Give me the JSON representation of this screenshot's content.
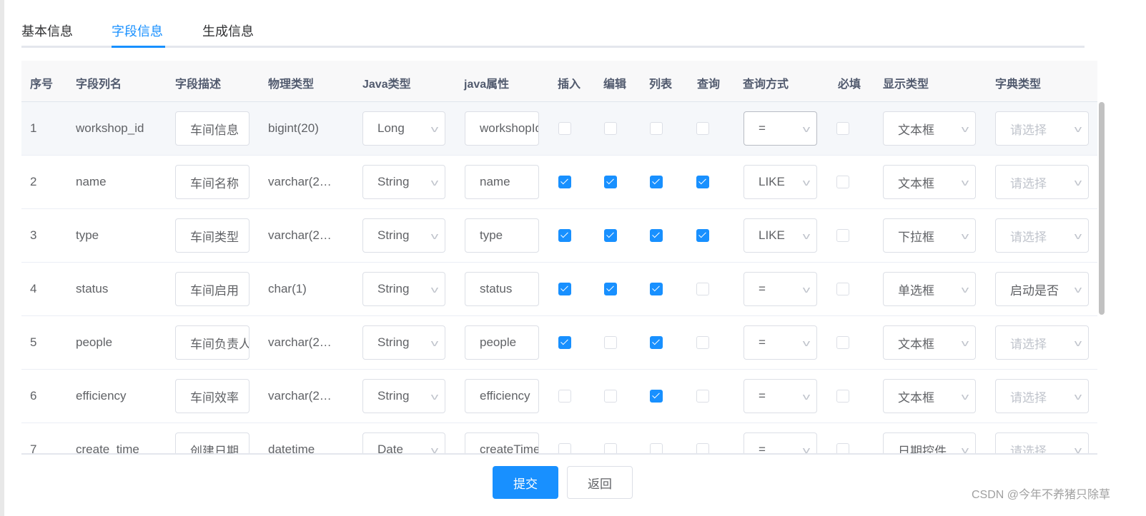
{
  "tabs": [
    {
      "label": "基本信息"
    },
    {
      "label": "字段信息",
      "active": true
    },
    {
      "label": "生成信息"
    }
  ],
  "accent_color": "#1890ff",
  "columns": [
    "序号",
    "字段列名",
    "字段描述",
    "物理类型",
    "Java类型",
    "java属性",
    "插入",
    "编辑",
    "列表",
    "查询",
    "查询方式",
    "必填",
    "显示类型",
    "字典类型"
  ],
  "dict_placeholder": "请选择",
  "rows": [
    {
      "no": "1",
      "column": "workshop_id",
      "desc": "车间信息",
      "phys": "bigint(20)",
      "java_type": "Long",
      "java_attr": "workshopId",
      "insert": false,
      "edit": false,
      "list": false,
      "query": false,
      "query_type": "=",
      "required": false,
      "display": "文本框",
      "dict": ""
    },
    {
      "no": "2",
      "column": "name",
      "desc": "车间名称",
      "phys": "varchar(2…",
      "java_type": "String",
      "java_attr": "name",
      "insert": true,
      "edit": true,
      "list": true,
      "query": true,
      "query_type": "LIKE",
      "required": false,
      "display": "文本框",
      "dict": ""
    },
    {
      "no": "3",
      "column": "type",
      "desc": "车间类型",
      "phys": "varchar(2…",
      "java_type": "String",
      "java_attr": "type",
      "insert": true,
      "edit": true,
      "list": true,
      "query": true,
      "query_type": "LIKE",
      "required": false,
      "display": "下拉框",
      "dict": ""
    },
    {
      "no": "4",
      "column": "status",
      "desc": "车间启用",
      "phys": "char(1)",
      "java_type": "String",
      "java_attr": "status",
      "insert": true,
      "edit": true,
      "list": true,
      "query": false,
      "query_type": "=",
      "required": false,
      "display": "单选框",
      "dict": "启动是否"
    },
    {
      "no": "5",
      "column": "people",
      "desc": "车间负责人",
      "phys": "varchar(2…",
      "java_type": "String",
      "java_attr": "people",
      "insert": true,
      "edit": false,
      "list": true,
      "query": false,
      "query_type": "=",
      "required": false,
      "display": "文本框",
      "dict": ""
    },
    {
      "no": "6",
      "column": "efficiency",
      "desc": "车间效率",
      "phys": "varchar(2…",
      "java_type": "String",
      "java_attr": "efficiency",
      "insert": false,
      "edit": false,
      "list": true,
      "query": false,
      "query_type": "=",
      "required": false,
      "display": "文本框",
      "dict": ""
    },
    {
      "no": "7",
      "column": "create_time",
      "desc": "创建日期",
      "phys": "datetime",
      "java_type": "Date",
      "java_attr": "createTime",
      "insert": false,
      "edit": false,
      "list": false,
      "query": false,
      "query_type": "=",
      "required": false,
      "display": "日期控件",
      "dict": ""
    }
  ],
  "buttons": {
    "submit": "提交",
    "back": "返回"
  },
  "watermark": "CSDN @今年不养猪只除草"
}
